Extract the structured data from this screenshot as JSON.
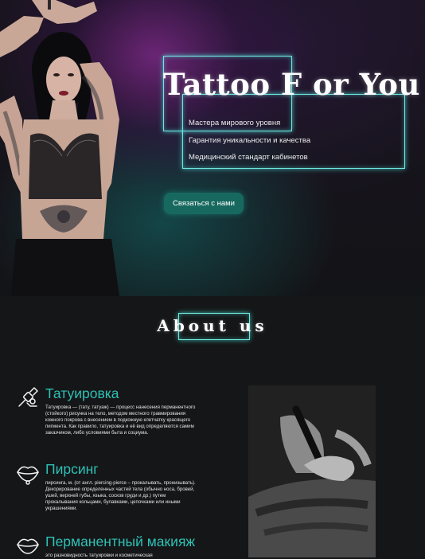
{
  "hero": {
    "title": "Tattoo F or You",
    "features": [
      "Мастера мирового уровня",
      "Гарантия уникальности и качества",
      "Медицинский стандарт кабинетов"
    ],
    "cta_label": "Связаться с нами"
  },
  "about": {
    "heading": "About us"
  },
  "services": [
    {
      "title": "Татуировка",
      "icon": "tattoo-machine-icon",
      "text": "Татуировка — (тату, татуаж) — процесс нанесения перманентного (стойкого) рисунка на тело, методом местного травмирования кожного покрова с внесением в подкожную клетчатку красящего пигмента. Как правило, татуировка и её вид определяются самим заказчиком, либо условиями быта и социума."
    },
    {
      "title": "Пирсинг",
      "icon": "pierced-lips-icon",
      "text": "пирсинга, м. (от англ. piercing-pierce – прокалывать, пронизывать). Декорирование определенных частей тела (обычно носа, бровей, ушей, верхней губы, языка, сосков груди и др.) путем прокалывания кольцами, булавками, цепочками или иными украшениями."
    },
    {
      "title": "Перманентный макияж",
      "icon": "lipstick-icon",
      "text": "это разновидность татуировки и косметическая"
    }
  ],
  "colors": {
    "accent": "#2ec0b6",
    "neon": "#6fe6df",
    "button": "#17695f",
    "background": "#151617"
  }
}
